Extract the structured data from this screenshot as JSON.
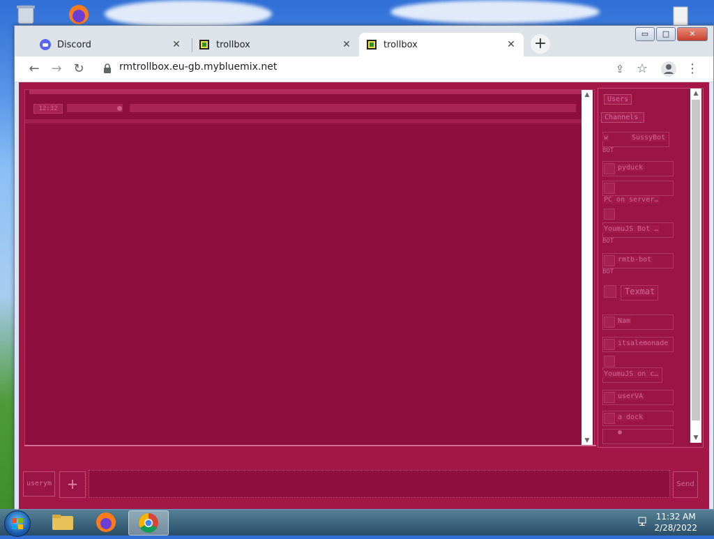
{
  "browser": {
    "tabs": [
      {
        "label": "Discord",
        "icon": "discord-icon",
        "active": false
      },
      {
        "label": "trollbox",
        "icon": "trollbox-icon",
        "active": false
      },
      {
        "label": "trollbox",
        "icon": "trollbox-icon",
        "active": true
      }
    ],
    "new_tab_symbol": "+",
    "url": "rmtrollbox.eu-gb.mybluemix.net",
    "window_buttons": {
      "minimize": "▭",
      "maximize": "□",
      "close": "✕"
    }
  },
  "chat": {
    "messages": [
      {
        "time": "12:32"
      }
    ]
  },
  "sidebar": {
    "users_button": "Users",
    "channels_button": "Channels",
    "users": [
      {
        "prefix": "w",
        "name": "SussyBot",
        "tag": "BOT"
      },
      {
        "name": "pyduck"
      },
      {
        "name": ""
      },
      {
        "name": "PC on server…"
      },
      {
        "name": "YoumuJS Bot …",
        "tag": "BOT"
      },
      {
        "name": "rmtb-bot",
        "tag": "BOT"
      },
      {
        "name": "Texmat"
      },
      {
        "name": "Nam"
      },
      {
        "name": "itsalemonade"
      },
      {
        "name": ""
      },
      {
        "name": "YoumuJS on c…"
      },
      {
        "name": "userVA"
      },
      {
        "name": "a dock"
      }
    ]
  },
  "input": {
    "username": "userym",
    "add_symbol": "+",
    "send_label": "Send"
  },
  "taskbar": {
    "time": "11:32 AM",
    "date": "2/28/2022"
  },
  "colors": {
    "panel": "#8e0e3d",
    "background": "#a31746",
    "accent": "#d1709a"
  }
}
